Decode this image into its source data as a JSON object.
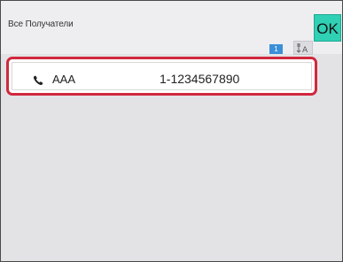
{
  "header": {
    "title": "Все Получатели",
    "ok_label": "OK"
  },
  "pagination": {
    "current_page": "1"
  },
  "toolbar": {
    "sort_icon": "sort-alphabet-icon"
  },
  "recipients": [
    {
      "icon": "phone-icon",
      "name": "AAA",
      "number": "1-1234567890",
      "selected": true
    }
  ],
  "colors": {
    "ok_button": "#2fd0b4",
    "selection_border": "#d0283e",
    "page_badge": "#3a8fd8"
  }
}
